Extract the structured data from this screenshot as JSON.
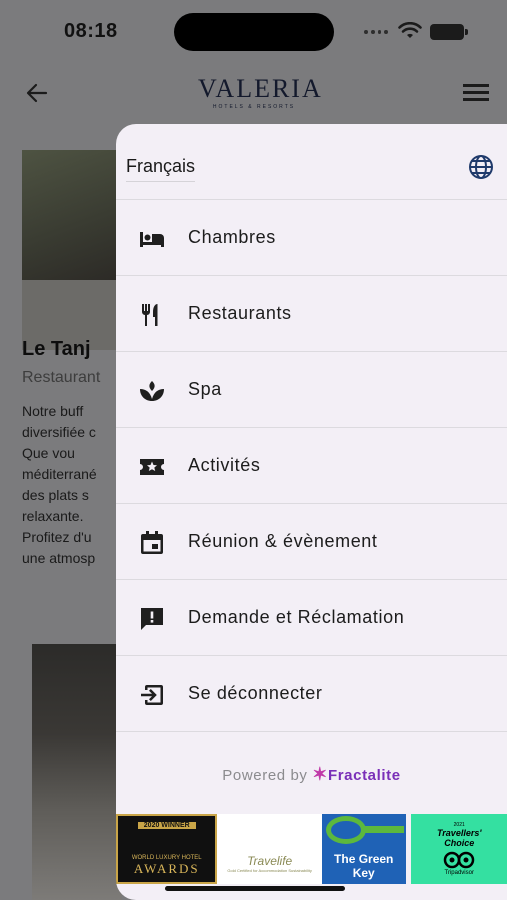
{
  "status_bar": {
    "time": "08:18"
  },
  "header": {
    "logo_main": "VALERIA",
    "logo_sub": "HOTELS & RESORTS"
  },
  "background": {
    "title": "Le Tanj",
    "subtitle": "Restaurant",
    "description_lines": [
      "Notre buff",
      "diversifiée c",
      "Que vou",
      "méditerrané",
      "des plats s",
      "relaxante.",
      "Profitez d'u",
      "une atmosp"
    ]
  },
  "drawer": {
    "language": "Français",
    "menu": [
      {
        "label": "Chambres",
        "icon": "bed-icon"
      },
      {
        "label": "Restaurants",
        "icon": "restaurant-icon"
      },
      {
        "label": "Spa",
        "icon": "spa-icon"
      },
      {
        "label": "Activités",
        "icon": "ticket-icon"
      },
      {
        "label": "Réunion & évènement",
        "icon": "calendar-icon"
      },
      {
        "label": "Demande et Réclamation",
        "icon": "feedback-icon"
      },
      {
        "label": "Se déconnecter",
        "icon": "logout-icon"
      }
    ],
    "powered_by": "Powered by",
    "powered_brand": "Fractalite",
    "awards": {
      "a1_top": "2020 WINNER",
      "a1_mid": "WORLD LUXURY HOTEL",
      "a1_big": "AWARDS",
      "a2_big": "Travelife",
      "a2_sm": "Gold Certified for Accommodation Sustainability",
      "a3_line1": "The Green",
      "a3_line2": "Key",
      "a4_year": "2021",
      "a4_line1": "Travellers'",
      "a4_line2": "Choice",
      "a4_brand": "Tripadvisor"
    }
  },
  "colors": {
    "drawer_bg": "#f3eff6",
    "overlay": "#7b7b7d",
    "accent": "#1f3a6b"
  }
}
